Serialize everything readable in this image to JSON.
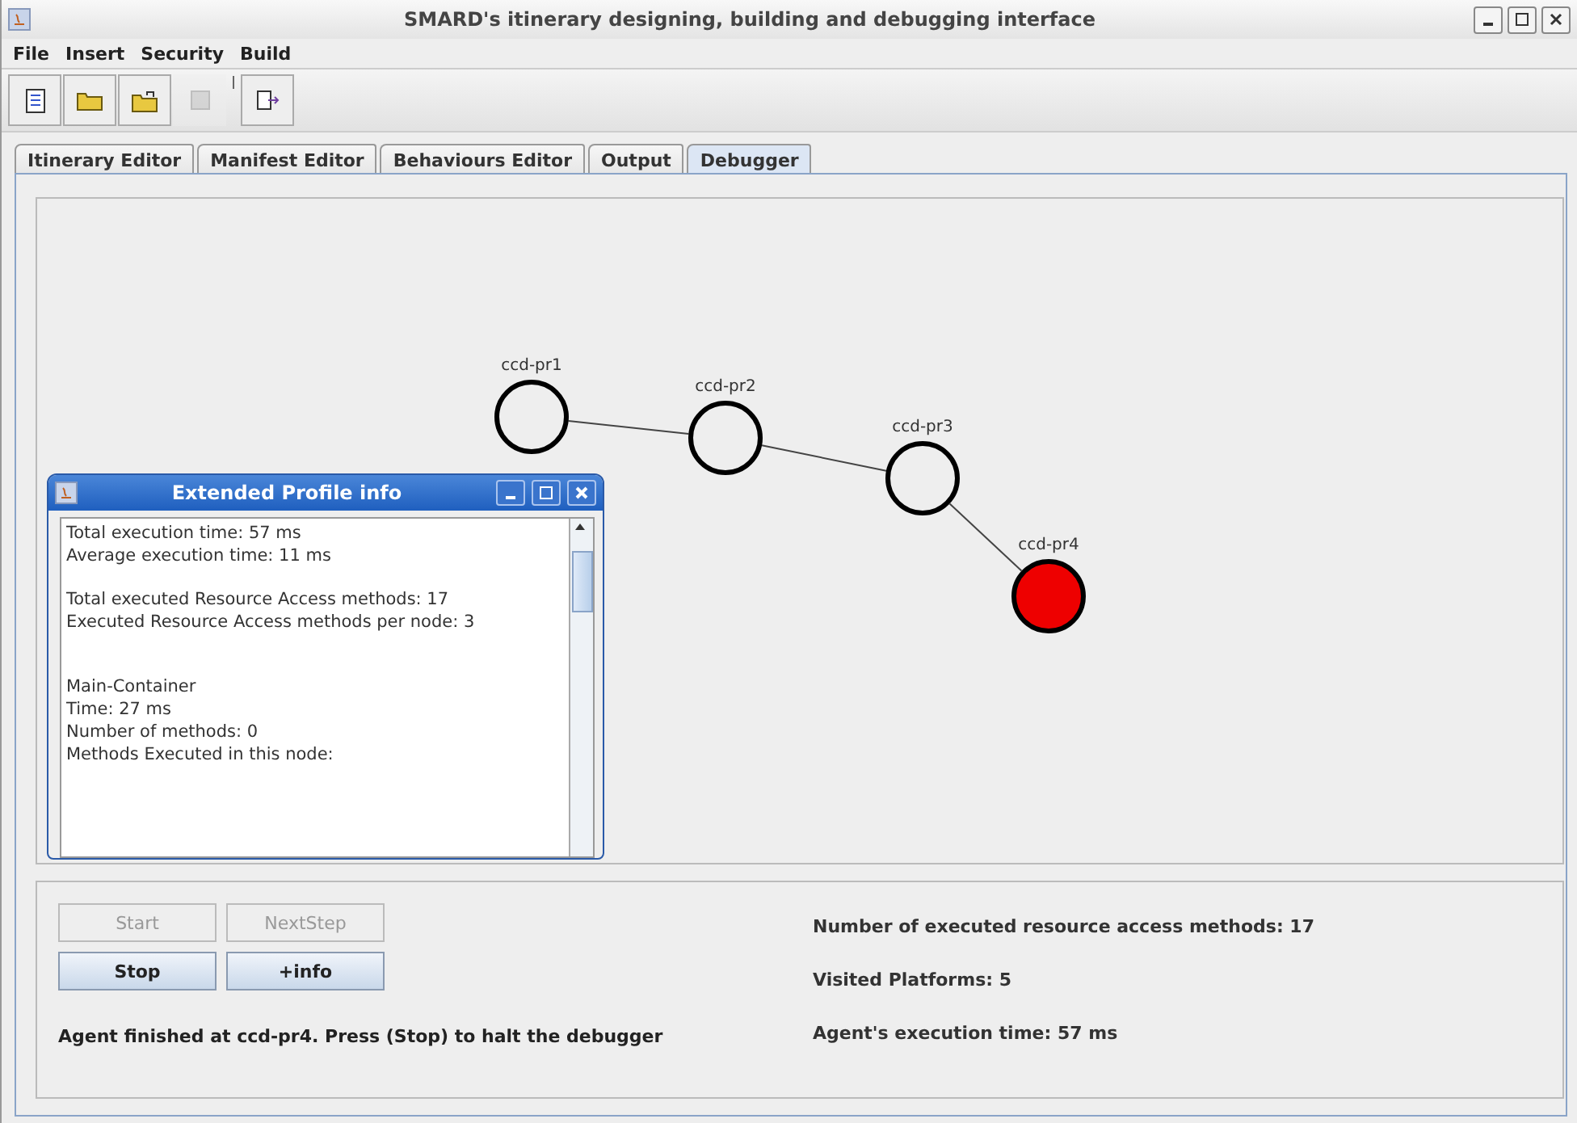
{
  "window": {
    "title": "SMARD's itinerary designing, building and debugging interface"
  },
  "menu": [
    "File",
    "Insert",
    "Security",
    "Build"
  ],
  "toolbar": [
    {
      "kind": "new",
      "disabled": false
    },
    {
      "kind": "open",
      "disabled": false
    },
    {
      "kind": "unlock",
      "disabled": false
    },
    {
      "kind": "save",
      "disabled": true
    },
    {
      "kind": "export",
      "disabled": false
    }
  ],
  "tabs": [
    {
      "label": "Itinerary Editor",
      "selected": false
    },
    {
      "label": "Manifest Editor",
      "selected": false
    },
    {
      "label": "Behaviours Editor",
      "selected": false
    },
    {
      "label": "Output",
      "selected": false
    },
    {
      "label": "Debugger",
      "selected": true
    }
  ],
  "graph": {
    "nodes": [
      {
        "label": "ccd-pr1",
        "current": false
      },
      {
        "label": "ccd-pr2",
        "current": false
      },
      {
        "label": "ccd-pr3",
        "current": false
      },
      {
        "label": "ccd-pr4",
        "current": true
      }
    ]
  },
  "profile_dialog": {
    "title": "Extended Profile info",
    "paragraphs": [
      [
        "Total execution time:  57 ms",
        "Average execution time:  11 ms"
      ],
      [
        "Total executed Resource Access methods:  17",
        "Executed Resource Access methods per node:  3"
      ],
      [
        "Main-Container",
        "Time: 27 ms",
        "Number of methods: 0",
        "Methods Executed in this node:"
      ]
    ]
  },
  "controls": {
    "buttons": [
      {
        "label": "Start",
        "disabled": true
      },
      {
        "label": "NextStep",
        "disabled": true
      },
      {
        "label": "Stop",
        "disabled": false
      },
      {
        "label": "+info",
        "disabled": false
      }
    ],
    "status": "Agent finished at ccd-pr4. Press (Stop) to halt the debugger"
  },
  "stats": [
    "Number of executed resource access methods: 17",
    "Visited Platforms: 5",
    "Agent's execution time: 57 ms"
  ]
}
